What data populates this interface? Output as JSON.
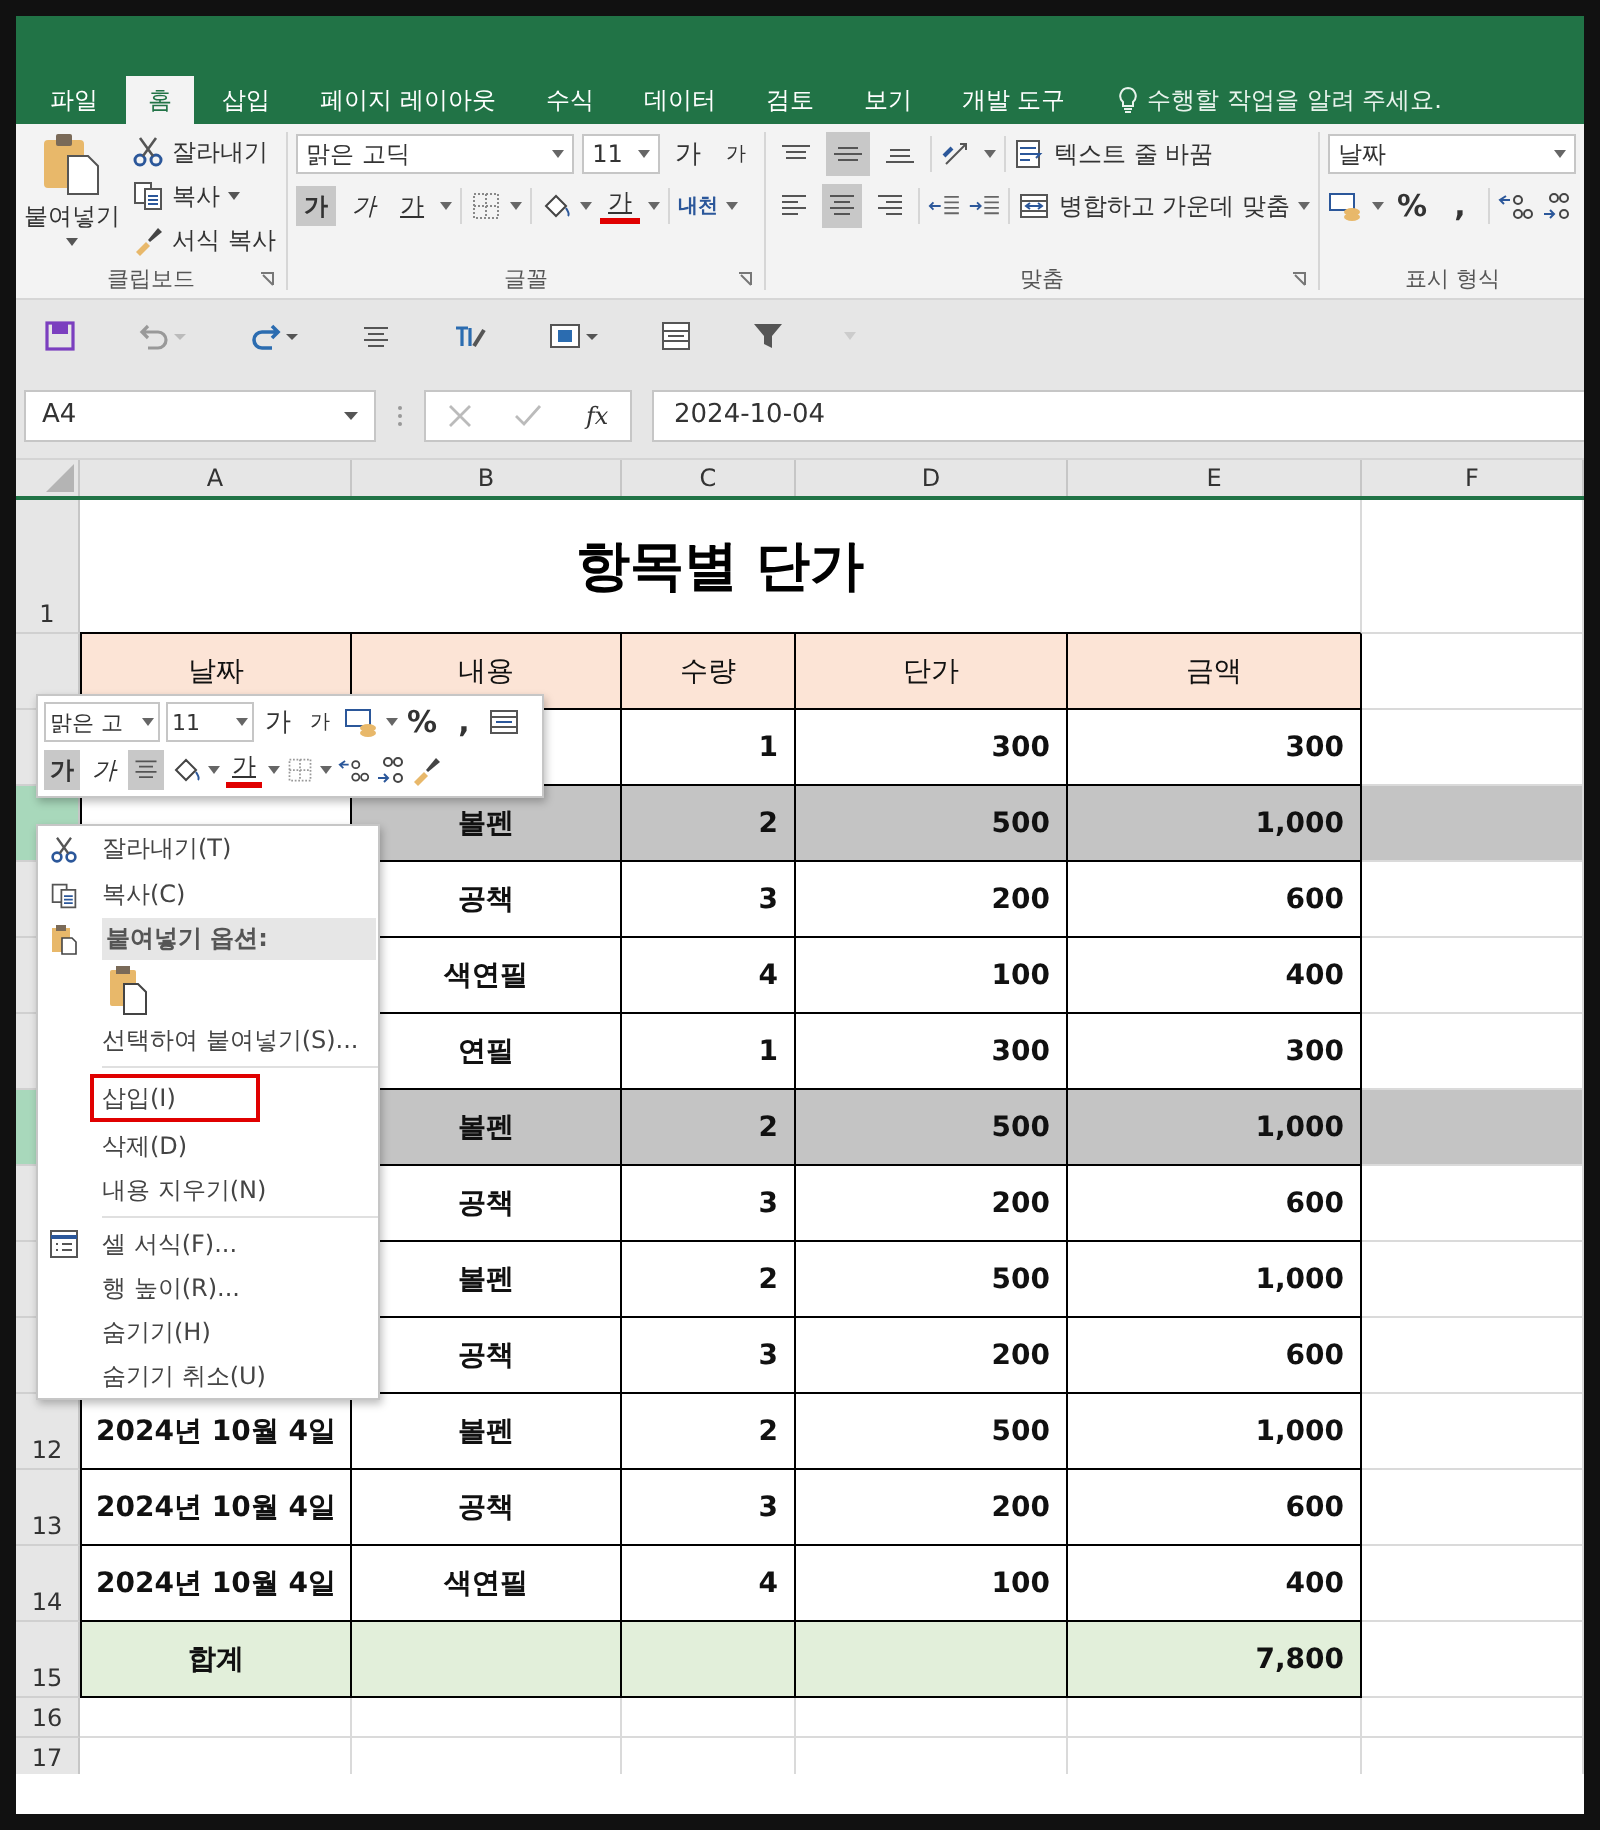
{
  "tabs": [
    {
      "label": "파일",
      "selected": false
    },
    {
      "label": "홈",
      "selected": true
    },
    {
      "label": "삽입",
      "selected": false
    },
    {
      "label": "페이지 레이아웃",
      "selected": false
    },
    {
      "label": "수식",
      "selected": false
    },
    {
      "label": "데이터",
      "selected": false
    },
    {
      "label": "검토",
      "selected": false
    },
    {
      "label": "보기",
      "selected": false
    },
    {
      "label": "개발 도구",
      "selected": false
    }
  ],
  "tell_me": {
    "placeholder": "수행할 작업을 알려 주세요."
  },
  "ribbon": {
    "clipboard": {
      "paste": "붙여넣기",
      "cut": "잘라내기",
      "copy": "복사",
      "format_painter": "서식 복사",
      "group_label": "클립보드"
    },
    "font": {
      "family": "맑은 고딕",
      "size": "11",
      "grow": "가",
      "shrink": "가",
      "styles": [
        {
          "kind": "bold",
          "label": "가",
          "pressed": true
        },
        {
          "kind": "italic",
          "label": "가",
          "pressed": false
        },
        {
          "kind": "underline",
          "label": "가",
          "pressed": false
        }
      ],
      "font_color": "가",
      "phonetic": "내천",
      "group_label": "글꼴"
    },
    "alignment": {
      "vertical": [
        {
          "kind": "top",
          "pressed": false
        },
        {
          "kind": "middle",
          "pressed": true
        },
        {
          "kind": "bottom",
          "pressed": false
        }
      ],
      "horizontal": [
        {
          "kind": "left",
          "pressed": false
        },
        {
          "kind": "center",
          "pressed": true
        },
        {
          "kind": "right",
          "pressed": false
        }
      ],
      "wrap_text": "텍스트 줄 바꿈",
      "merge": "병합하고 가운데 맞춤",
      "group_label": "맞춤"
    },
    "number": {
      "format": "날짜",
      "percent": "%",
      "comma": ",",
      "group_label": "표시 형식"
    }
  },
  "formula_bar": {
    "name_box": "A4",
    "function_symbol": "fx",
    "value": "2024-10-04"
  },
  "sheet": {
    "columns": [
      "A",
      "B",
      "C",
      "D",
      "E",
      "F"
    ],
    "title_row": {
      "number": "1",
      "title": "항목별 단가"
    },
    "header_row": {
      "cells": [
        "날짜",
        "내용",
        "수량",
        "단가",
        "금액"
      ]
    },
    "rows": [
      {
        "selected": false,
        "quantity": "1",
        "unit_price": "300",
        "amount": "300"
      },
      {
        "selected": true,
        "item": "볼펜",
        "quantity": "2",
        "unit_price": "500",
        "amount": "1,000"
      },
      {
        "selected": false,
        "item": "공책",
        "quantity": "3",
        "unit_price": "200",
        "amount": "600"
      },
      {
        "selected": false,
        "item": "색연필",
        "quantity": "4",
        "unit_price": "100",
        "amount": "400"
      },
      {
        "selected": false,
        "item": "연필",
        "quantity": "1",
        "unit_price": "300",
        "amount": "300"
      },
      {
        "selected": true,
        "item": "볼펜",
        "quantity": "2",
        "unit_price": "500",
        "amount": "1,000"
      },
      {
        "selected": false,
        "item": "공책",
        "quantity": "3",
        "unit_price": "200",
        "amount": "600"
      },
      {
        "selected": false,
        "item": "볼펜",
        "quantity": "2",
        "unit_price": "500",
        "amount": "1,000"
      },
      {
        "selected": false,
        "item": "공책",
        "quantity": "3",
        "unit_price": "200",
        "amount": "600"
      },
      {
        "number": "12",
        "selected": false,
        "date": "2024년 10월 4일",
        "item": "볼펜",
        "quantity": "2",
        "unit_price": "500",
        "amount": "1,000"
      },
      {
        "number": "13",
        "selected": false,
        "date": "2024년 10월 4일",
        "item": "공책",
        "quantity": "3",
        "unit_price": "200",
        "amount": "600"
      },
      {
        "number": "14",
        "selected": false,
        "date": "2024년 10월 4일",
        "item": "색연필",
        "quantity": "4",
        "unit_price": "100",
        "amount": "400"
      }
    ],
    "total_row": {
      "number": "15",
      "label": "합계",
      "amount": "7,800"
    },
    "empty_rows": [
      "16",
      "17"
    ]
  },
  "mini_toolbar": {
    "font": "맑은 고",
    "size": "11",
    "grow": "가",
    "shrink": "가",
    "percent": "%",
    "comma": ",",
    "buttons": [
      {
        "kind": "bold",
        "label": "가",
        "pressed": true
      },
      {
        "kind": "italic",
        "label": "가",
        "pressed": false
      },
      {
        "kind": "center",
        "pressed": true
      }
    ],
    "font_color": "가"
  },
  "context_menu": [
    {
      "kind": "cut",
      "label": "잘라내기(T)",
      "annotated": false
    },
    {
      "kind": "copy",
      "label": "복사(C)",
      "annotated": false
    },
    {
      "kind": "heading",
      "label": "붙여넣기 옵션:",
      "annotated": false
    },
    {
      "kind": "paste"
    },
    {
      "kind": "command",
      "label": "선택하여 붙여넣기(S)...",
      "annotated": false
    },
    {
      "kind": "separator"
    },
    {
      "kind": "command",
      "label": "삽입(I)",
      "annotated": true
    },
    {
      "kind": "command",
      "label": "삭제(D)",
      "annotated": false
    },
    {
      "kind": "command",
      "label": "내용 지우기(N)",
      "annotated": false
    },
    {
      "kind": "separator"
    },
    {
      "kind": "format",
      "label": "셀 서식(F)...",
      "annotated": false
    },
    {
      "kind": "command",
      "label": "행 높이(R)...",
      "annotated": false
    },
    {
      "kind": "command",
      "label": "숨기기(H)",
      "annotated": false
    },
    {
      "kind": "command",
      "label": "숨기기 취소(U)",
      "annotated": false
    }
  ]
}
